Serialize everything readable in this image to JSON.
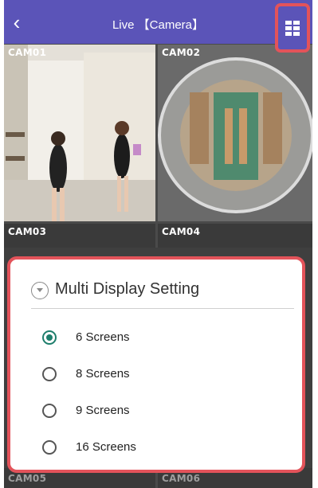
{
  "header": {
    "back_icon": "back-chevron-icon",
    "title": "Live 【Camera】",
    "layout_icon": "grid-layout-icon",
    "accent": "#5b54b8",
    "highlight": "#e3535a"
  },
  "cameras": [
    {
      "label": "CAM01"
    },
    {
      "label": "CAM02"
    },
    {
      "label": "CAM03"
    },
    {
      "label": "CAM04"
    },
    {
      "label": "CAM05"
    },
    {
      "label": "CAM06"
    }
  ],
  "dialog": {
    "icon": "chevron-down-circle-icon",
    "title": "Multi Display Setting",
    "options": [
      {
        "label": "6 Screens",
        "selected": true
      },
      {
        "label": "8 Screens",
        "selected": false
      },
      {
        "label": "9 Screens",
        "selected": false
      },
      {
        "label": "16 Screens",
        "selected": false
      }
    ],
    "selected_color": "#1e7e6c"
  }
}
